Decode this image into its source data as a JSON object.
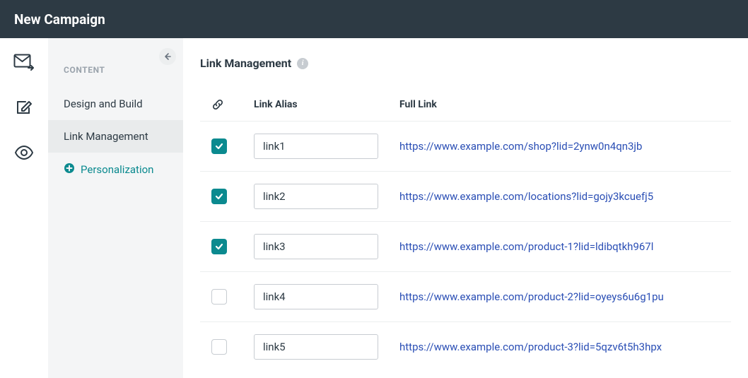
{
  "header": {
    "title": "New Campaign"
  },
  "sidebar": {
    "section_label": "CONTENT",
    "items": [
      {
        "label": "Design and Build",
        "active": false,
        "special": false
      },
      {
        "label": "Link Management",
        "active": true,
        "special": false
      },
      {
        "label": "Personalization",
        "active": false,
        "special": true
      }
    ]
  },
  "main": {
    "title": "Link Management",
    "columns": {
      "alias": "Link Alias",
      "full": "Full Link"
    },
    "rows": [
      {
        "checked": true,
        "alias": "link1",
        "url": "https://www.example.com/shop?lid=2ynw0n4qn3jb"
      },
      {
        "checked": true,
        "alias": "link2",
        "url": "https://www.example.com/locations?lid=gojy3kcuefj5"
      },
      {
        "checked": true,
        "alias": "link3",
        "url": "https://www.example.com/product-1?lid=ldibqtkh967l"
      },
      {
        "checked": false,
        "alias": "link4",
        "url": "https://www.example.com/product-2?lid=oyeys6u6g1pu"
      },
      {
        "checked": false,
        "alias": "link5",
        "url": "https://www.example.com/product-3?lid=5qzv6t5h3hpx"
      }
    ]
  },
  "icons": {
    "info_glyph": "i"
  }
}
